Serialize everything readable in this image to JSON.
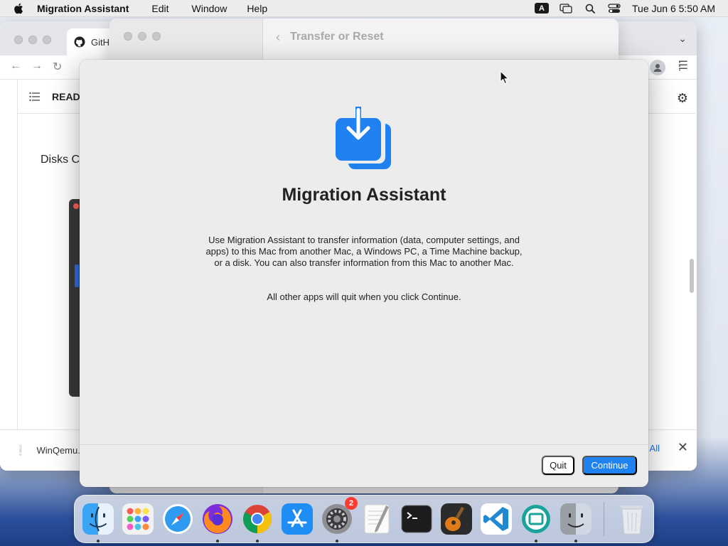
{
  "menubar": {
    "app_name": "Migration Assistant",
    "items": [
      "Edit",
      "Window",
      "Help"
    ],
    "input_source": "A",
    "clock": "Tue Jun 6  5:50 AM"
  },
  "browser": {
    "tab_title": "GitH",
    "readme_label": "READ",
    "body_text": "Disks C",
    "download_name": "WinQemu.",
    "show_all": "All"
  },
  "settings": {
    "title": "Transfer or Reset"
  },
  "dialog": {
    "title": "Migration Assistant",
    "description": "Use Migration Assistant to transfer information (data, computer settings, and apps) to this Mac from another Mac, a Windows PC, a Time Machine backup, or a disk. You can also transfer information from this Mac to another Mac.",
    "note": "All other apps will quit when you click Continue.",
    "quit_label": "Quit",
    "continue_label": "Continue",
    "accent_color": "#1f82f0"
  },
  "dock": {
    "apps": [
      {
        "name": "finder-icon",
        "running": true
      },
      {
        "name": "launchpad-icon",
        "running": false
      },
      {
        "name": "safari-icon",
        "running": false
      },
      {
        "name": "firefox-icon",
        "running": true
      },
      {
        "name": "chrome-icon",
        "running": true
      },
      {
        "name": "app-store-icon",
        "running": false
      },
      {
        "name": "system-settings-icon",
        "running": true,
        "badge": "2"
      },
      {
        "name": "textedit-icon",
        "running": false
      },
      {
        "name": "terminal-icon",
        "running": false
      },
      {
        "name": "garageband-icon",
        "running": false
      },
      {
        "name": "vscode-icon",
        "running": false
      },
      {
        "name": "qemu-icon",
        "running": true
      },
      {
        "name": "migration-assistant-icon",
        "running": true
      }
    ],
    "settings_badge": "2"
  }
}
